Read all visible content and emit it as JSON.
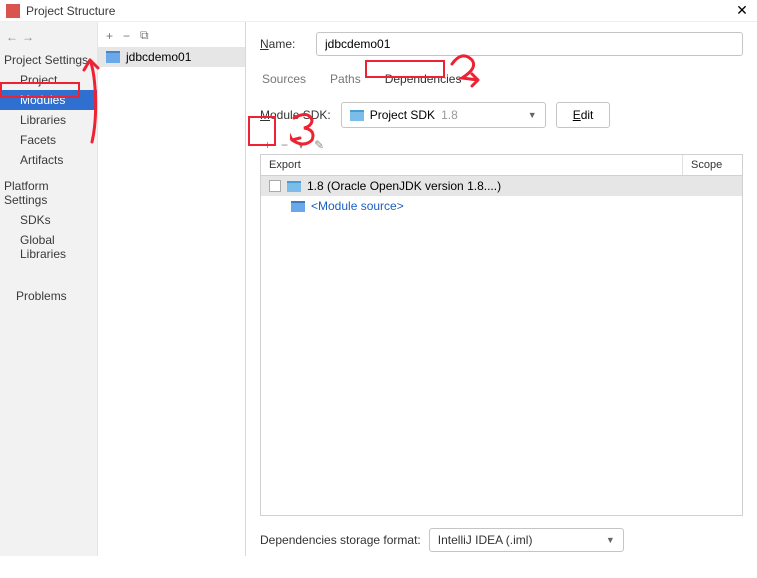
{
  "title": "Project Structure",
  "sidebar": {
    "nav_back": "←",
    "nav_fwd": "→",
    "section1": "Project Settings",
    "items1": [
      "Project",
      "Modules",
      "Libraries",
      "Facets",
      "Artifacts"
    ],
    "selected": "Modules",
    "section2": "Platform Settings",
    "items2": [
      "SDKs",
      "Global Libraries"
    ],
    "section3_item": "Problems"
  },
  "mid": {
    "plus": "+",
    "minus": "−",
    "copy": "⧉",
    "module": "jdbcdemo01"
  },
  "main": {
    "name_label": "Name:",
    "name_value": "jdbcdemo01",
    "tabs": [
      "Sources",
      "Paths",
      "Dependencies"
    ],
    "active_tab": "Dependencies",
    "sdk_label": "Module SDK:",
    "sdk_value_pre": "Project SDK",
    "sdk_value_suf": "1.8",
    "edit": "Edit",
    "tools": {
      "plus": "+",
      "minus": "−",
      "down": "▾",
      "edit": "✎"
    },
    "col_export": "Export",
    "col_scope": "Scope",
    "dep1": "1.8 (Oracle OpenJDK version 1.8....)",
    "dep2": "<Module source>",
    "footer_label": "Dependencies storage format:",
    "footer_value": "IntelliJ IDEA (.iml)"
  }
}
